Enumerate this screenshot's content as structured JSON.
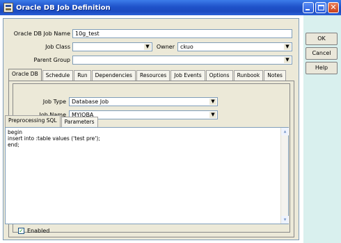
{
  "window": {
    "title": "Oracle DB Job Definition"
  },
  "form": {
    "job_name_label": "Oracle DB Job Name",
    "job_name_value": "10g_test",
    "job_class_label": "Job Class",
    "job_class_value": "",
    "owner_label": "Owner",
    "owner_value": "ckuo",
    "parent_group_label": "Parent Group",
    "parent_group_value": ""
  },
  "tabs": [
    {
      "label": "Oracle DB",
      "active": true
    },
    {
      "label": "Schedule"
    },
    {
      "label": "Run"
    },
    {
      "label": "Dependencies"
    },
    {
      "label": "Resources"
    },
    {
      "label": "Job Events"
    },
    {
      "label": "Options"
    },
    {
      "label": "Runbook"
    },
    {
      "label": "Notes"
    }
  ],
  "oracle_tab": {
    "job_type_label": "Job Type",
    "job_type_value": "Database Job",
    "job_name_label": "Job Name",
    "job_name_value": "MYJOBA"
  },
  "subtabs": [
    {
      "label": "Preprocessing SQL",
      "active": true
    },
    {
      "label": "Parameters"
    }
  ],
  "sql_lines": [
    "begin",
    "insert into :table values ('test pre');",
    "end;"
  ],
  "side_buttons": {
    "ok": "OK",
    "cancel": "Cancel",
    "help": "Help"
  },
  "enabled": {
    "label": "Enabled",
    "checked": true
  }
}
